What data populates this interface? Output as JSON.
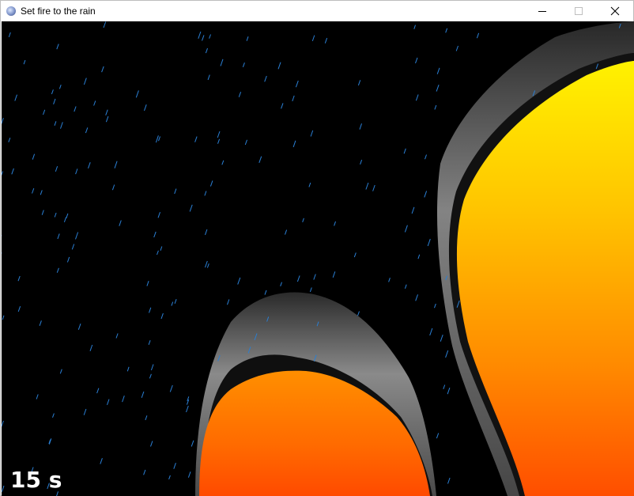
{
  "window": {
    "title": "Set fire to the rain",
    "icon": "app-icon",
    "controls": {
      "minimize_icon": "minimize-icon",
      "maximize_icon": "maximize-icon",
      "close_icon": "close-icon"
    }
  },
  "game": {
    "background_color": "#000000",
    "rain_color": "#2a7fd4",
    "fire_colors": {
      "top": "#fff200",
      "middle": "#ff9a00",
      "bottom": "#ff4a00"
    },
    "smoke_colors": [
      "#5c5c5c",
      "#7a7a7a",
      "#9a9a9a"
    ],
    "timer_text": "15 s"
  }
}
